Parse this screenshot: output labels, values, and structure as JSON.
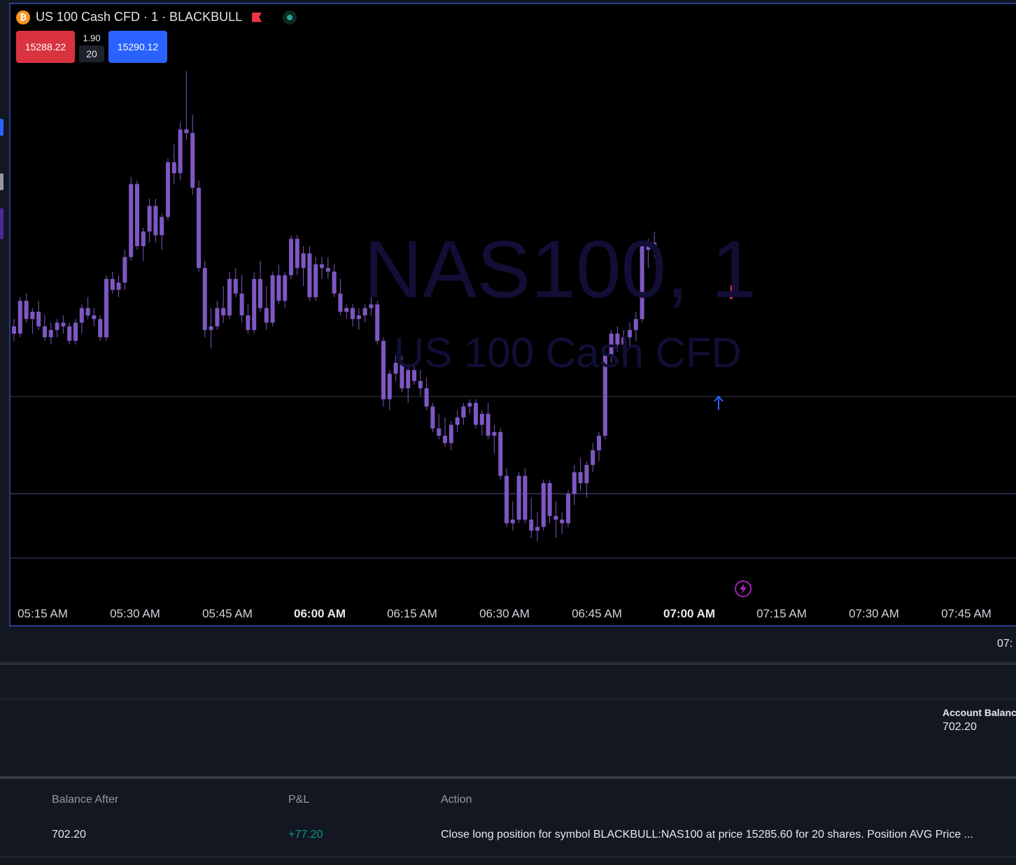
{
  "header": {
    "symbol_title": "US 100 Cash CFD · 1 · BLACKBULL",
    "coin_glyph": "₿",
    "sell_price": "15288.22",
    "buy_price": "15290.12",
    "spread": "1.90",
    "quantity": "20"
  },
  "watermark": {
    "main": "NAS100, 1",
    "sub": "US 100 Cash CFD"
  },
  "time_axis": {
    "labels": [
      "05:15 AM",
      "05:30 AM",
      "05:45 AM",
      "06:00 AM",
      "06:15 AM",
      "06:30 AM",
      "06:45 AM",
      "07:00 AM",
      "07:15 AM",
      "07:30 AM",
      "07:45 AM"
    ],
    "bold_labels": [
      "06:00 AM",
      "07:00 AM"
    ]
  },
  "colors": {
    "candle_body": "#7e57c2",
    "candle_wick": "#7e57c2",
    "sell": "#d93340",
    "buy": "#2962ff",
    "sell_arrow": "#f23645",
    "buy_arrow": "#2962ff",
    "level_line": "#5b4e9a",
    "profit": "#089981"
  },
  "icons": {
    "coin": "bitcoin-icon",
    "flag": "flag-icon",
    "live": "live-status-icon",
    "bolt": "lightning-icon",
    "sell_arrow": "arrow-down-icon",
    "buy_arrow": "arrow-up-icon"
  },
  "bottom_panel": {
    "time_partial": "07:",
    "account_balance_label": "Account Balanc",
    "account_balance_value": "702.20",
    "table": {
      "headers": [
        "Balance After",
        "P&L",
        "Action"
      ],
      "rows": [
        {
          "balance_after": "702.20",
          "pnl": "+77.20",
          "action": "Close long position for symbol BLACKBULL:NAS100 at price 15285.60 for 20 shares. Position AVG Price ..."
        }
      ]
    }
  },
  "chart_data": {
    "type": "candlestick",
    "interval": "1",
    "x_range": [
      "05:15 AM",
      "07:45 AM"
    ],
    "signals": [
      {
        "type": "sell",
        "time": "07:05 AM"
      },
      {
        "type": "buy",
        "time": "07:03 AM"
      }
    ],
    "candles_ohlc": [
      [
        15287,
        15289,
        15283,
        15285
      ],
      [
        15285,
        15295,
        15284,
        15294
      ],
      [
        15294,
        15296,
        15288,
        15289
      ],
      [
        15289,
        15292,
        15285,
        15291
      ],
      [
        15291,
        15294,
        15286,
        15287
      ],
      [
        15287,
        15290,
        15283,
        15284
      ],
      [
        15284,
        15288,
        15282,
        15286
      ],
      [
        15286,
        15289,
        15284,
        15288
      ],
      [
        15288,
        15290,
        15285,
        15287
      ],
      [
        15287,
        15288,
        15282,
        15283
      ],
      [
        15283,
        15289,
        15282,
        15288
      ],
      [
        15288,
        15293,
        15285,
        15292
      ],
      [
        15292,
        15295,
        15289,
        15290
      ],
      [
        15290,
        15292,
        15287,
        15289
      ],
      [
        15289,
        15290,
        15283,
        15284
      ],
      [
        15284,
        15301,
        15283,
        15300
      ],
      [
        15300,
        15302,
        15296,
        15297
      ],
      [
        15297,
        15301,
        15295,
        15299
      ],
      [
        15299,
        15308,
        15297,
        15306
      ],
      [
        15306,
        15328,
        15305,
        15326
      ],
      [
        15326,
        15327,
        15308,
        15309
      ],
      [
        15309,
        15314,
        15305,
        15313
      ],
      [
        15313,
        15322,
        15310,
        15320
      ],
      [
        15320,
        15322,
        15310,
        15312
      ],
      [
        15312,
        15318,
        15308,
        15317
      ],
      [
        15317,
        15333,
        15316,
        15332
      ],
      [
        15332,
        15337,
        15326,
        15329
      ],
      [
        15329,
        15343,
        15327,
        15341
      ],
      [
        15341,
        15357,
        15338,
        15340
      ],
      [
        15340,
        15345,
        15323,
        15325
      ],
      [
        15325,
        15327,
        15302,
        15303
      ],
      [
        15303,
        15305,
        15284,
        15286
      ],
      [
        15286,
        15292,
        15281,
        15287
      ],
      [
        15287,
        15294,
        15286,
        15292
      ],
      [
        15292,
        15298,
        15288,
        15290
      ],
      [
        15290,
        15302,
        15289,
        15300
      ],
      [
        15300,
        15303,
        15295,
        15296
      ],
      [
        15296,
        15301,
        15288,
        15290
      ],
      [
        15290,
        15293,
        15285,
        15286
      ],
      [
        15286,
        15302,
        15285,
        15300
      ],
      [
        15300,
        15305,
        15291,
        15292
      ],
      [
        15292,
        15298,
        15286,
        15288
      ],
      [
        15288,
        15302,
        15287,
        15301
      ],
      [
        15301,
        15304,
        15293,
        15294
      ],
      [
        15294,
        15302,
        15292,
        15301
      ],
      [
        15301,
        15312,
        15300,
        15311
      ],
      [
        15311,
        15312,
        15301,
        15303
      ],
      [
        15303,
        15309,
        15298,
        15307
      ],
      [
        15307,
        15309,
        15294,
        15295
      ],
      [
        15295,
        15306,
        15294,
        15304
      ],
      [
        15304,
        15306,
        15300,
        15303
      ],
      [
        15303,
        15306,
        15300,
        15302
      ],
      [
        15302,
        15304,
        15295,
        15296
      ],
      [
        15296,
        15300,
        15290,
        15291
      ],
      [
        15291,
        15293,
        15289,
        15292
      ],
      [
        15292,
        15293,
        15287,
        15289
      ],
      [
        15289,
        15292,
        15286,
        15290
      ],
      [
        15290,
        15293,
        15288,
        15292
      ],
      [
        15292,
        15295,
        15290,
        15293
      ],
      [
        15293,
        15294,
        15282,
        15283
      ],
      [
        15283,
        15284,
        15265,
        15267
      ],
      [
        15267,
        15275,
        15264,
        15274
      ],
      [
        15274,
        15279,
        15272,
        15277
      ],
      [
        15277,
        15279,
        15269,
        15270
      ],
      [
        15270,
        15276,
        15266,
        15275
      ],
      [
        15275,
        15277,
        15271,
        15272
      ],
      [
        15272,
        15275,
        15268,
        15270
      ],
      [
        15270,
        15273,
        15264,
        15265
      ],
      [
        15265,
        15266,
        15258,
        15259
      ],
      [
        15259,
        15263,
        15256,
        15257
      ],
      [
        15257,
        15262,
        15254,
        15255
      ],
      [
        15255,
        15261,
        15253,
        15260
      ],
      [
        15260,
        15264,
        15258,
        15262
      ],
      [
        15262,
        15266,
        15260,
        15265
      ],
      [
        15265,
        15267,
        15263,
        15266
      ],
      [
        15266,
        15267,
        15259,
        15260
      ],
      [
        15260,
        15264,
        15257,
        15263
      ],
      [
        15263,
        15266,
        15256,
        15257
      ],
      [
        15257,
        15260,
        15252,
        15258
      ],
      [
        15258,
        15259,
        15245,
        15246
      ],
      [
        15246,
        15248,
        15232,
        15233
      ],
      [
        15233,
        15239,
        15231,
        15234
      ],
      [
        15234,
        15247,
        15233,
        15246
      ],
      [
        15246,
        15248,
        15233,
        15234
      ],
      [
        15234,
        15240,
        15229,
        15231
      ],
      [
        15231,
        15236,
        15228,
        15232
      ],
      [
        15232,
        15245,
        15231,
        15244
      ],
      [
        15244,
        15245,
        15233,
        15235
      ],
      [
        15235,
        15239,
        15229,
        15234
      ],
      [
        15234,
        15236,
        15230,
        15233
      ],
      [
        15233,
        15242,
        15232,
        15241
      ],
      [
        15241,
        15249,
        15238,
        15247
      ],
      [
        15247,
        15251,
        15242,
        15244
      ],
      [
        15244,
        15250,
        15240,
        15249
      ],
      [
        15249,
        15255,
        15247,
        15253
      ],
      [
        15253,
        15258,
        15250,
        15257
      ],
      [
        15257,
        15280,
        15256,
        15279
      ],
      [
        15279,
        15286,
        15277,
        15285
      ],
      [
        15285,
        15287,
        15280,
        15282
      ],
      [
        15282,
        15286,
        15278,
        15284
      ],
      [
        15284,
        15288,
        15281,
        15286
      ],
      [
        15286,
        15291,
        15283,
        15289
      ],
      [
        15289,
        15310,
        15288,
        15309
      ],
      [
        15309,
        15311,
        15303,
        15308
      ],
      [
        15308,
        15313,
        15306,
        15310
      ]
    ]
  }
}
